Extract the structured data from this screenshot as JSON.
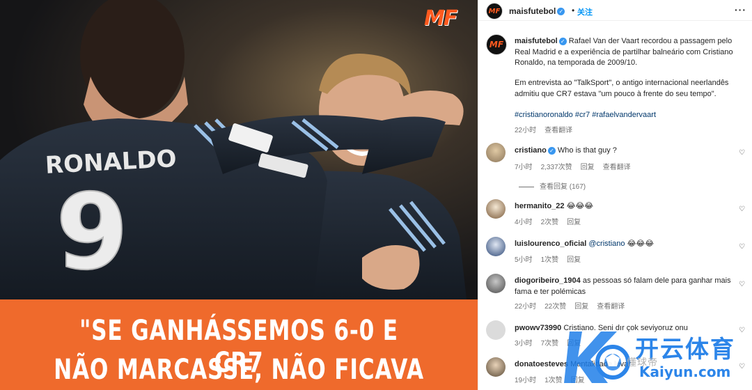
{
  "post": {
    "logo": "MF",
    "jersey_name": "RONALDO",
    "jersey_number": "9",
    "quote_lines": [
      "\"SE GANHÁSSEMOS 6-0 E CR7",
      "NÃO MARCASSE, NÃO FICAVA"
    ],
    "banner_color": "#ef6a2c",
    "logo_color": "#ff5a1f"
  },
  "header": {
    "username": "maisfutebol",
    "separator": "•",
    "follow_label": "关注",
    "more_icon": "more-icon"
  },
  "caption": {
    "username": "maisfutebol",
    "p1": "Rafael Van der Vaart recordou a passagem pelo Real Madrid e a experiência de partilhar balneário com Cristiano Ronaldo, na temporada de 2009/10.",
    "p2": "Em entrevista ao \"TalkSport\", o antigo internacional neerlandês admitiu que CR7 estava \"um pouco à frente do seu tempo\".",
    "hashtags": "#cristianoronaldo #cr7 #rafaelvandervaart",
    "time": "22小时",
    "translate": "查看翻译"
  },
  "comments": [
    {
      "username": "cristiano",
      "verified": true,
      "text": "Who is that guy ?",
      "time": "7小时",
      "likes": "2,337次赞",
      "reply": "回复",
      "translate": "查看翻译",
      "view_replies": "查看回复 (167)"
    },
    {
      "username": "hermanito_22",
      "text": "😂😂😂",
      "time": "4小时",
      "likes": "2次赞",
      "reply": "回复"
    },
    {
      "username": "luislourenco_oficial",
      "mention": "@cristiano",
      "text": "😂😂😂",
      "time": "5小时",
      "likes": "1次赞",
      "reply": "回复"
    },
    {
      "username": "diogoribeiro_1904",
      "text": "as pessoas só falam dele para ganhar mais fama e ter polémicas",
      "time": "22小时",
      "likes": "22次赞",
      "reply": "回复",
      "translate": "查看翻译"
    },
    {
      "username": "pwowv73990",
      "text": "Cristiano. Seni dır çok seviyoruz onu",
      "time": "3小时",
      "likes": "7次赞",
      "reply": "回复"
    },
    {
      "username": "donatoesteves",
      "text": "Mentalidade levar",
      "time": "19小时",
      "likes": "1次赞",
      "reply": "回复"
    }
  ],
  "watermark": {
    "cn": "开云体育",
    "en": "Kaiyun.com",
    "faint": "懂球帝"
  },
  "colors": {
    "link": "#00376b",
    "follow": "#0095f6",
    "verified": "#3897f0",
    "meta": "#737373"
  }
}
